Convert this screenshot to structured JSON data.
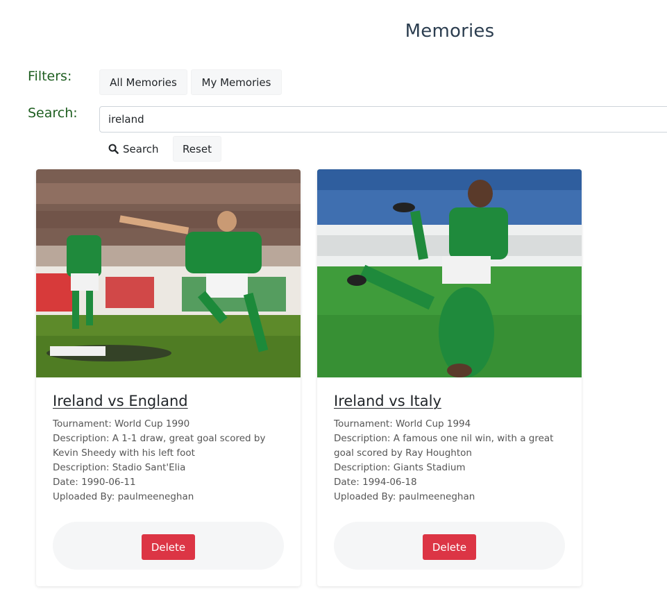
{
  "header": {
    "title": "Memories"
  },
  "filters": {
    "label": "Filters:",
    "all_label": "All Memories",
    "mine_label": "My Memories"
  },
  "search": {
    "label": "Search:",
    "value": "ireland",
    "search_button": "Search",
    "reset_button": "Reset"
  },
  "memories": [
    {
      "title": "Ireland vs England",
      "tournament": "Tournament: World Cup 1990",
      "description": "Description: A 1-1 draw, great goal scored by Kevin Sheedy with his left foot",
      "venue": "Description: Stadio Sant'Elia",
      "date": "Date: 1990-06-11",
      "uploaded_by": "Uploaded By: paulmeeneghan",
      "delete_label": "Delete"
    },
    {
      "title": "Ireland vs Italy",
      "tournament": "Tournament: World Cup 1994",
      "description": "Description: A famous one nil win, with a great goal scored by Ray Houghton",
      "venue": "Description: Giants Stadium",
      "date": "Date: 1994-06-18",
      "uploaded_by": "Uploaded By: paulmeeneghan",
      "delete_label": "Delete"
    }
  ],
  "colors": {
    "title": "#2c3e50",
    "label_green": "#1e5e20",
    "delete_red": "#dc3545",
    "button_light": "#f6f7f8"
  },
  "icons": {
    "search": "search-icon"
  }
}
